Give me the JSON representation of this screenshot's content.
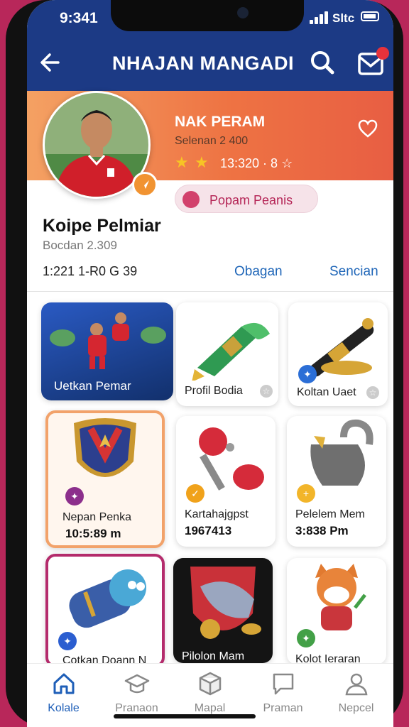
{
  "status": {
    "time": "9:341",
    "carrier": "Sltc"
  },
  "appbar": {
    "title": "NHAJAN MANGADI",
    "badge_count": ""
  },
  "profile": {
    "name": "NAK PERAM",
    "subtitle": "Selenan 2 400",
    "rating_stars": 2,
    "stat": "13:320 · 8 ☆",
    "pill_label": "Popam Peanis"
  },
  "section": {
    "title": "Koipe Pelmiar",
    "subtitle": "Bocdan 2.309",
    "stat": "1:221 1-R0 G 39",
    "link_left": "Obagan",
    "link_right": "Sencian"
  },
  "cards": [
    {
      "label": "Uetkan Pemar"
    },
    {
      "label": "Profil Bodia"
    },
    {
      "label": "Koltan Uaet"
    },
    {
      "label": "Nepan Penka",
      "value": "10:5:89 m"
    },
    {
      "label": "Kartahajgpst",
      "value": "1967413"
    },
    {
      "label": "Pelelem Mem",
      "value": "3:838 Pm"
    },
    {
      "label": "Cotkan Doann N"
    },
    {
      "label": "Pilolon Mam"
    },
    {
      "label": "Kolot Ieraran"
    }
  ],
  "tabs": [
    {
      "label": "Kolale",
      "icon": "home-icon",
      "active": true
    },
    {
      "label": "Pranaon",
      "icon": "cap-icon",
      "active": false
    },
    {
      "label": "Mapal",
      "icon": "box-icon",
      "active": false
    },
    {
      "label": "Praman",
      "icon": "chat-icon",
      "active": false
    },
    {
      "label": "Nepcel",
      "icon": "user-icon",
      "active": false
    }
  ],
  "colors": {
    "primary": "#1c3a85",
    "accent": "#ee7343",
    "link": "#1f66b8",
    "highlight": "#b42b6c"
  }
}
